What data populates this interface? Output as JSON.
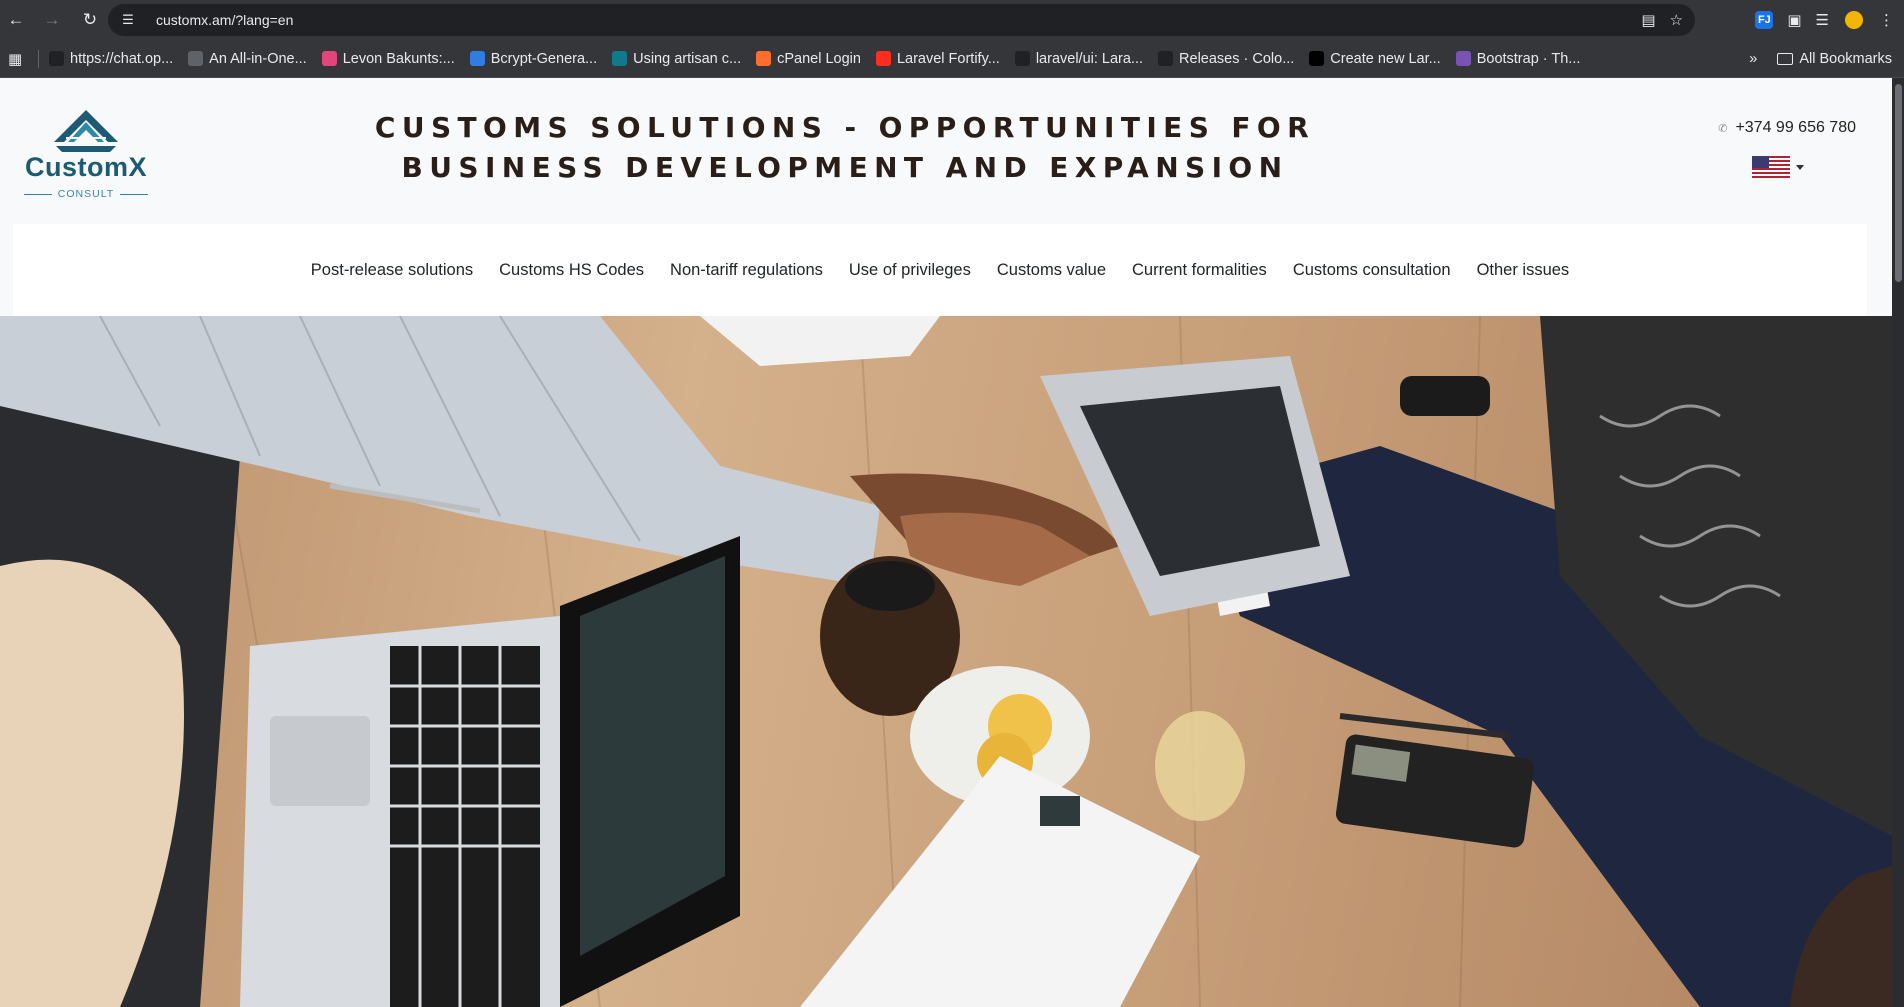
{
  "browser": {
    "url": "customx.am/?lang=en",
    "bookmarks": [
      {
        "label": "https://chat.op...",
        "icon": "openai-icon",
        "color": "#202124"
      },
      {
        "label": "An All-in-One...",
        "icon": "globe-icon",
        "color": "#5f6368"
      },
      {
        "label": "Levon Bakunts:...",
        "icon": "colorful-circle-icon",
        "color": "#e0457b"
      },
      {
        "label": "Bcrypt-Genera...",
        "icon": "bcrypt-icon",
        "color": "#2f7de1"
      },
      {
        "label": "Using artisan c...",
        "icon": "s-icon",
        "color": "#0f7a8a"
      },
      {
        "label": "cPanel Login",
        "icon": "cpanel-icon",
        "color": "#ff6c2c"
      },
      {
        "label": "Laravel Fortify...",
        "icon": "laravel-icon",
        "color": "#ff2d20"
      },
      {
        "label": "laravel/ui: Lara...",
        "icon": "github-icon",
        "color": "#202124"
      },
      {
        "label": "Releases · Colo...",
        "icon": "github-icon",
        "color": "#202124"
      },
      {
        "label": "Create new Lar...",
        "icon": "medium-icon",
        "color": "#000000"
      },
      {
        "label": "Bootstrap · Th...",
        "icon": "bootstrap-icon",
        "color": "#7952b3"
      }
    ],
    "more_label": "»",
    "all_bookmarks_label": "All Bookmarks"
  },
  "site": {
    "logo": {
      "name": "CustomX",
      "sub": "CONSULT",
      "color": "#1e5a73"
    },
    "headline": "CUSTOMS SOLUTIONS - OPPORTUNITIES FOR BUSINESS DEVELOPMENT AND EXPANSION",
    "phone": "+374 99 656 780",
    "language": {
      "selected": "en",
      "flag": "us-flag-icon"
    },
    "nav": [
      "Post-release solutions",
      "Customs HS Codes",
      "Non-tariff regulations",
      "Use of privileges",
      "Customs value",
      "Current formalities",
      "Customs consultation",
      "Other issues"
    ]
  },
  "hero": {
    "image": "business-handshake-meeting-photo"
  }
}
